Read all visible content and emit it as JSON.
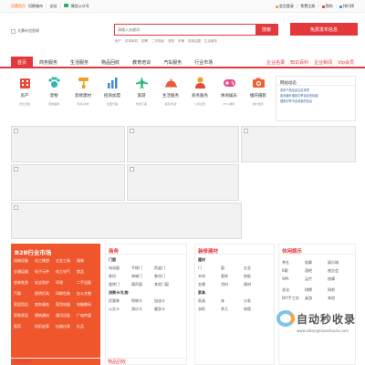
{
  "topbar": {
    "left": [
      "设置首页",
      "切换城市",
      "全站",
      "微信公众号"
    ],
    "right": [
      "会员登录",
      "免费注册",
      "我的",
      "排行榜"
    ]
  },
  "logo": {
    "alt": "大黄叶信息网"
  },
  "search": {
    "placeholder": "请输入关键词",
    "button": "搜索",
    "hotwords": [
      "房产",
      "供求商机",
      "招聘",
      "二手物品",
      "宠物",
      "车辆",
      "招商加盟",
      "生活服务"
    ]
  },
  "publish_button": "免费发布信息",
  "nav": {
    "items": [
      "首页",
      "商务服务",
      "生活服务",
      "物品回收",
      "教育培训",
      "汽车服务",
      "行业市场"
    ],
    "right": [
      "企业名录",
      "知识百科",
      "企业新闻",
      "Vip会员"
    ]
  },
  "categories": [
    {
      "name": "房产",
      "sub": "出售出租",
      "icon": "building-icon",
      "color": "#e84b3c"
    },
    {
      "name": "宠物",
      "sub": "宠物猫狗",
      "icon": "paw-icon",
      "color": "#2eb6a7"
    },
    {
      "name": "装修建材",
      "sub": "家具/建材",
      "icon": "roller-icon",
      "color": "#f0a020"
    },
    {
      "name": "招商加盟",
      "sub": "加盟代理",
      "icon": "chart-icon",
      "color": "#3b8ad8"
    },
    {
      "name": "旅游",
      "sub": "旅游门票",
      "icon": "plane-icon",
      "color": "#2eb67d"
    },
    {
      "name": "生活服务",
      "sub": "搬家/家政",
      "icon": "bell-icon",
      "color": "#e8583c"
    },
    {
      "name": "商务服务",
      "sub": "公司注册",
      "icon": "person-icon",
      "color": "#f0a020"
    },
    {
      "name": "休闲娱乐",
      "sub": "KTV/酒吧",
      "icon": "game-icon",
      "color": "#e84b8a"
    },
    {
      "name": "婚庆摄影",
      "sub": "婚纱摄影",
      "icon": "camera-icon",
      "color": "#f06030"
    }
  ],
  "news": {
    "title": "网站动态",
    "items": [
      "发布产品信息注意事项",
      "如何编写搜索引擎喜欢的标题",
      "搜索引擎不会收录的信息"
    ]
  },
  "b2b": {
    "title": "B2B行业市场",
    "items": [
      "机械设备",
      "化工橡塑",
      "五金工具",
      "服装",
      "交通运输",
      "电子元件",
      "电工电气",
      "食品",
      "农林牧渔",
      "安全防护",
      "环保",
      "二手设备",
      "汽摩",
      "照明灯具",
      "印刷包装",
      "办公文教",
      "家居用品",
      "商务服务",
      "家用电器",
      "电脑数码",
      "家装家居",
      "建筑建材",
      "通讯设备",
      "广电传媒",
      "医药",
      "纺织皮革",
      "仪器仪表",
      "礼品"
    ]
  },
  "col_business": {
    "title": "商务",
    "group1": "门窗",
    "row1": [
      "电动窗",
      "平移门",
      "防盗门"
    ],
    "row2": [
      "屏风",
      "伸缩门",
      "卷帘门"
    ],
    "row3": [
      "旋转门",
      "隔声窗",
      "其他门窗"
    ],
    "group2": "消费卡/礼物",
    "row4": [
      "优惠券",
      "购物卡",
      "加油卡"
    ],
    "row5": [
      "公交卡",
      "游乐卡",
      "健身卡"
    ]
  },
  "col_building": {
    "title": "装修建材",
    "group1": "建材",
    "row1": [
      "门",
      "窗",
      "五金"
    ],
    "row2": [
      "木材",
      "瓷砖",
      "地板"
    ],
    "row3": [
      "金属",
      "涂料",
      "建材"
    ],
    "group2": "家具",
    "row4": [
      "家具",
      "床",
      "沙发"
    ],
    "row5": [
      "衣柜",
      "茶几",
      "地毯"
    ]
  },
  "col_leisure": {
    "title": "休闲娱乐",
    "group1": "",
    "row1": [
      "茶社",
      "陪聊",
      "娱乐城"
    ],
    "row2": [
      "K歌",
      "酒吧",
      "夜总会"
    ],
    "row3": [
      "SPA",
      "足疗",
      "按摩"
    ],
    "group2": "",
    "row4": [
      "洗浴",
      "棋牌",
      "网吧"
    ],
    "row5": [
      "DIY手工坊",
      "桌游",
      "其他"
    ]
  },
  "watermark": {
    "text": "自动秒收录",
    "sub": "www.zidongmiaoshoulu.com"
  },
  "bottom": [
    "汽车服务",
    "物品回收"
  ]
}
